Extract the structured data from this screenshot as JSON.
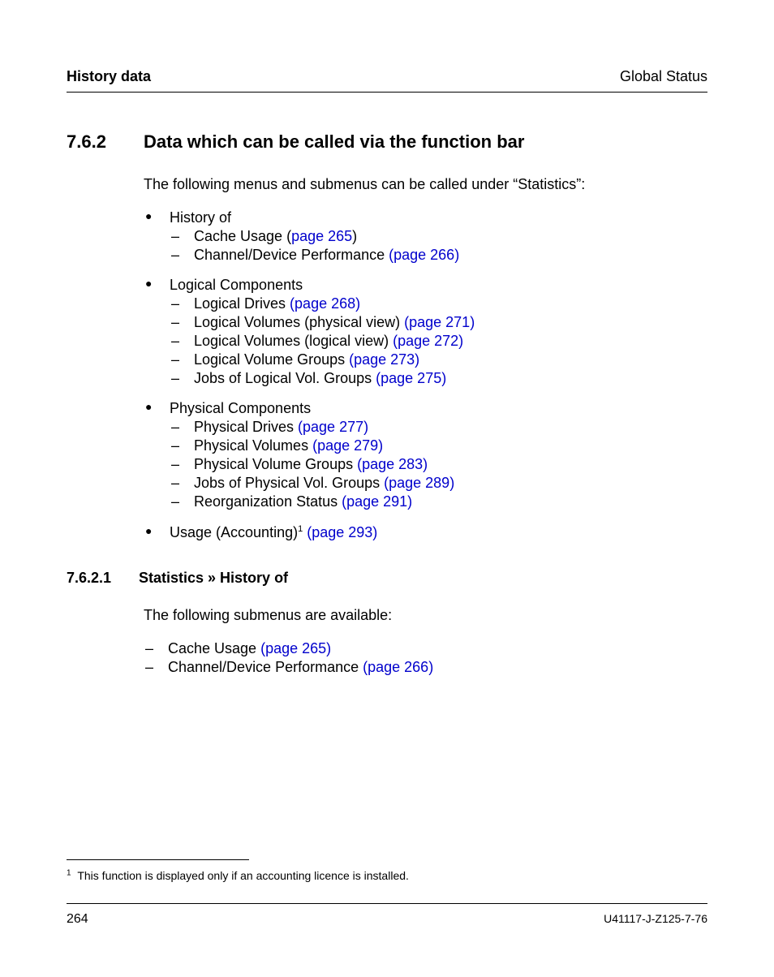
{
  "header": {
    "left": "History data",
    "right": "Global Status"
  },
  "section": {
    "number": "7.6.2",
    "title": "Data which can be called via the function bar",
    "intro": "The following menus and submenus can be called under “Statistics”:"
  },
  "groups": [
    {
      "label": "History of",
      "items": [
        {
          "text": "Cache Usage (",
          "link": "page 265",
          "tail": ")"
        },
        {
          "text": "Channel/Device Performance ",
          "link": "(page 266)",
          "tail": ""
        }
      ]
    },
    {
      "label": "Logical Components",
      "items": [
        {
          "text": "Logical Drives ",
          "link": "(page 268)",
          "tail": ""
        },
        {
          "text": "Logical Volumes (physical view) ",
          "link": "(page 271)",
          "tail": ""
        },
        {
          "text": "Logical Volumes (logical view) ",
          "link": "(page 272)",
          "tail": ""
        },
        {
          "text": "Logical Volume Groups ",
          "link": "(page 273)",
          "tail": ""
        },
        {
          "text": "Jobs of Logical Vol. Groups ",
          "link": "(page 275)",
          "tail": ""
        }
      ]
    },
    {
      "label": "Physical Components",
      "items": [
        {
          "text": "Physical Drives ",
          "link": "(page 277)",
          "tail": ""
        },
        {
          "text": "Physical Volumes ",
          "link": "(page 279)",
          "tail": ""
        },
        {
          "text": "Physical Volume Groups ",
          "link": "(page 283)",
          "tail": ""
        },
        {
          "text": "Jobs of Physical Vol. Groups ",
          "link": "(page 289)",
          "tail": ""
        },
        {
          "text": "Reorganization Status ",
          "link": "(page 291)",
          "tail": ""
        }
      ]
    }
  ],
  "usage": {
    "label": "Usage (Accounting)",
    "sup": "1",
    "link": "(page 293)"
  },
  "subsection": {
    "number": "7.6.2.1",
    "title": "Statistics » History of",
    "intro": "The following submenus are available:",
    "items": [
      {
        "text": "Cache Usage ",
        "link": "(page 265)",
        "tail": ""
      },
      {
        "text": "Channel/Device Performance ",
        "link": "(page 266)",
        "tail": ""
      }
    ]
  },
  "footnote": {
    "marker": "1",
    "text": "This function is displayed only if an accounting licence is installed."
  },
  "footer": {
    "page": "264",
    "docid": "U41117-J-Z125-7-76"
  }
}
